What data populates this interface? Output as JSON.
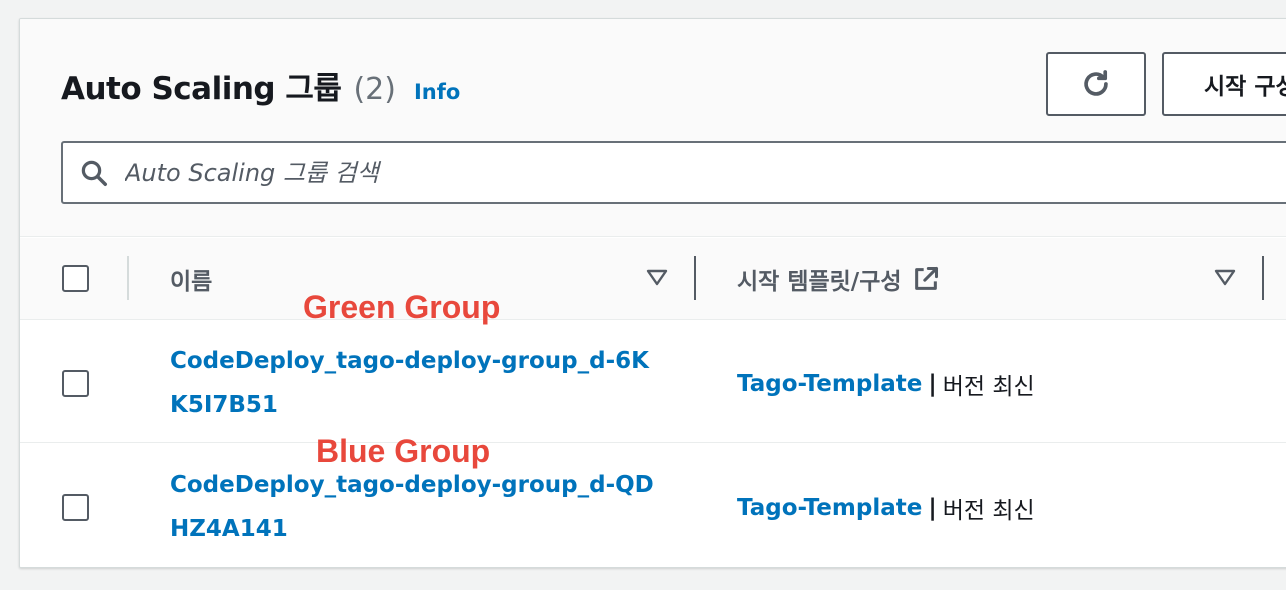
{
  "header": {
    "title": "Auto Scaling 그룹",
    "count": "(2)",
    "info_label": "Info",
    "refresh_icon": "refresh-icon",
    "launch_button_label": "시작 구성"
  },
  "search": {
    "placeholder": "Auto Scaling 그룹 검색",
    "value": ""
  },
  "table": {
    "columns": [
      {
        "label": "이름"
      },
      {
        "label": "시작 템플릿/구성"
      }
    ],
    "rows": [
      {
        "name": "CodeDeploy_tago-deploy-group_d-6KK5I7B51",
        "template": "Tago-Template",
        "separator": "|",
        "version": "버전 최신",
        "annotation": "Green Group"
      },
      {
        "name": "CodeDeploy_tago-deploy-group_d-QDHZ4A141",
        "template": "Tago-Template",
        "separator": "|",
        "version": "버전 최신",
        "annotation": "Blue Group"
      }
    ]
  },
  "colors": {
    "link": "#0073bb",
    "annotation": "#e8483c",
    "text": "#16191f",
    "muted": "#545b64"
  }
}
